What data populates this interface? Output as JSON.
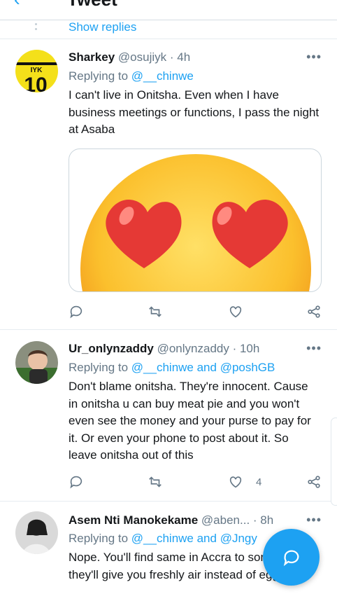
{
  "header": {
    "back_icon": "back-arrow-icon",
    "title": "Tweet"
  },
  "thread": {
    "show_replies_label": "Show replies"
  },
  "tweets": [
    {
      "name": "Sharkey",
      "handle": "@osujiyk",
      "time": "· 4h",
      "replying_prefix": "Replying to",
      "replying_to": "@__chinwe",
      "text": "I can't live in Onitsha. Even when I have business meetings or functions, I pass the night at Asaba",
      "avatar_text": "IYK",
      "avatar_number": "10",
      "media_icon": "heart-eyes-emoji-icon",
      "likes": ""
    },
    {
      "name": "Ur_onlynzaddy",
      "handle": "@onlynzaddy",
      "time": "· 10h",
      "replying_prefix": "Replying to",
      "replying_to": "@__chinwe and @poshGB",
      "text": "Don't blame onitsha. They're innocent. Cause in onitsha u can buy meat pie and you won't even see the money and your purse to pay for it. Or even your phone to post about it.  So leave onitsha out of this",
      "likes": "4"
    },
    {
      "name": "Asem Nti Manokekame",
      "handle": "@aben...",
      "time": "· 8h",
      "replying_prefix": "Replying to",
      "replying_to": "@__chinwe and @Jngy",
      "text": "Nope. You'll find same in Accra to sometimes, they'll give you freshly air instead of egg.",
      "likes": ""
    }
  ],
  "icons": {
    "reply": "reply-icon",
    "retweet": "retweet-icon",
    "like": "like-icon",
    "share": "share-icon",
    "more": "more-icon",
    "compose": "compose-reply-icon"
  },
  "colors": {
    "accent": "#1da1f2",
    "secondary_text": "#657786",
    "divider": "#e6ecf0"
  }
}
